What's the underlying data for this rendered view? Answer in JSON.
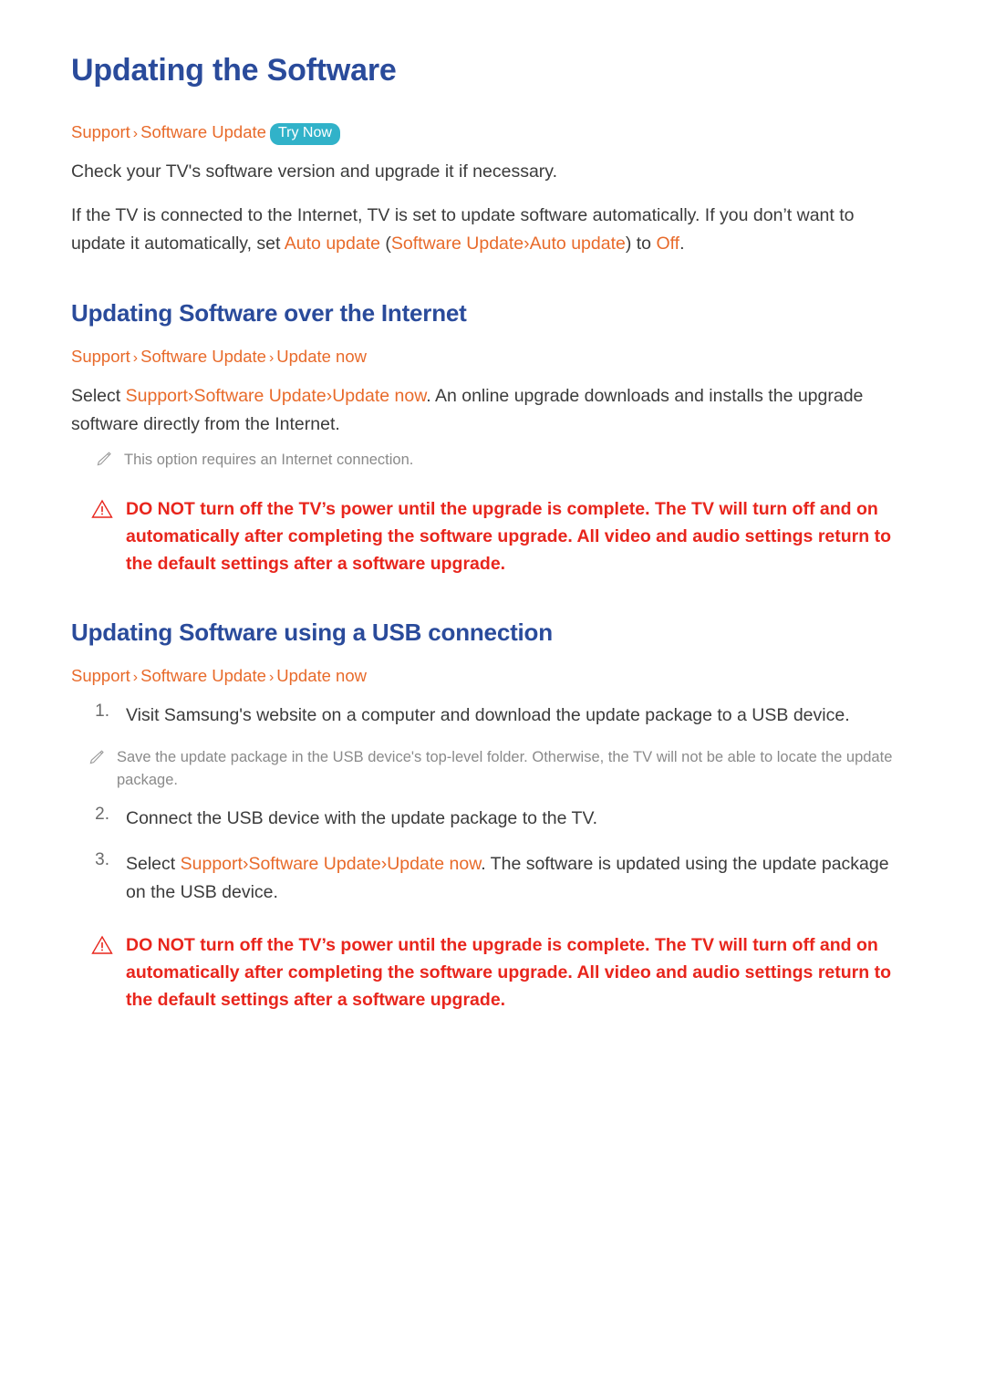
{
  "doc": {
    "title": "Updating the Software",
    "colors": {
      "heading": "#2a4b9b",
      "path": "#e86a2a",
      "warning": "#e8251c",
      "badge": "#31b2c9",
      "note": "#8a8a8a",
      "body": "#3b3b3b"
    }
  },
  "intro": {
    "path": {
      "part1": "Support",
      "sep1": "›",
      "part2": "Software Update",
      "badge": "Try Now"
    },
    "para1": "Check your TV's software version and upgrade it if necessary.",
    "para2_a": "If the TV is connected to the Internet, TV is set to update software automatically. If you don’t want to update it automatically, set ",
    "para2_b": "Auto update",
    "para2_c": " (",
    "para2_d": "Software Update",
    "para2_e": "›",
    "para2_f": "Auto update",
    "para2_g": ") to ",
    "para2_h": "Off",
    "para2_i": "."
  },
  "section_internet": {
    "title": "Updating Software over the Internet",
    "path": {
      "part1": "Support",
      "sep1": "›",
      "part2": "Software Update",
      "sep2": "›",
      "part3": "Update now"
    },
    "para_a": "Select ",
    "para_b": "Support",
    "para_c": "›",
    "para_d": "Software Update",
    "para_e": "›",
    "para_f": "Update now",
    "para_g": ". An online upgrade downloads and installs the upgrade software directly from the Internet.",
    "note": "This option requires an Internet connection.",
    "warning": "DO NOT turn off the TV’s power until the upgrade is complete. The TV will turn off and on automatically after completing the software upgrade. All video and audio settings return to the default settings after a software upgrade."
  },
  "section_usb": {
    "title": "Updating Software using a USB connection",
    "path": {
      "part1": "Support",
      "sep1": "›",
      "part2": "Software Update",
      "sep2": "›",
      "part3": "Update now"
    },
    "steps": [
      {
        "num": "1.",
        "text": "Visit Samsung's website on a computer and download the update package to a USB device.",
        "note": "Save the update package in the USB device's top-level folder. Otherwise, the TV will not be able to locate the update package."
      },
      {
        "num": "2.",
        "text": "Connect the USB device with the update package to the TV.",
        "note": ""
      },
      {
        "num": "3.",
        "text_a": "Select ",
        "text_b": "Support",
        "text_c": "›",
        "text_d": "Software Update",
        "text_e": "›",
        "text_f": "Update now",
        "text_g": ". The software is updated using the update package on the USB device.",
        "note": ""
      }
    ],
    "warning": "DO NOT turn off the TV’s power until the upgrade is complete. The TV will turn off and on automatically after completing the software upgrade. All video and audio settings return to the default settings after a software upgrade."
  },
  "icons": {
    "note": "pencil-icon",
    "warning": "warning-triangle-icon"
  }
}
